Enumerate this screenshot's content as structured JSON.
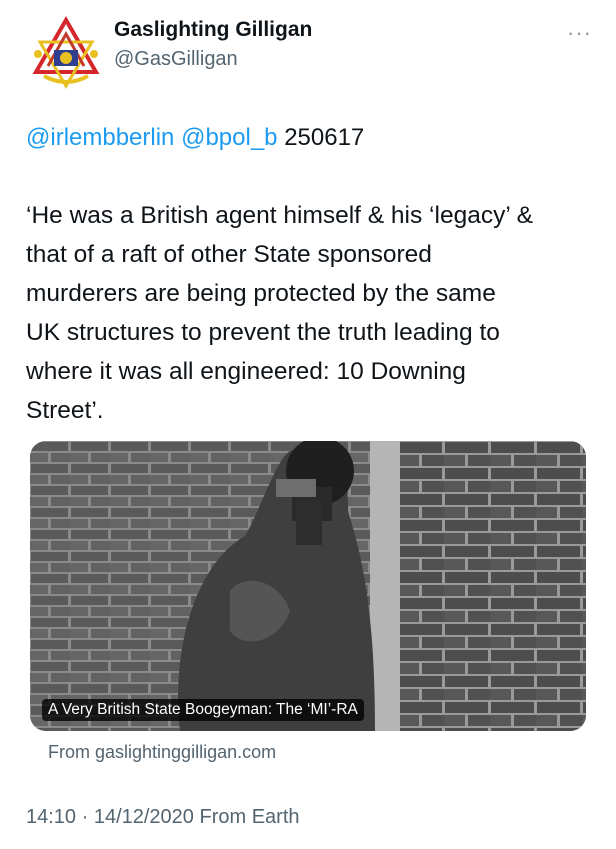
{
  "author": {
    "name": "Gaslighting Gilligan",
    "handle": "@GasGilligan",
    "avatar_icon": "masonic-emblem-icon",
    "more_label": "···"
  },
  "tweet": {
    "mention1": "@irlembberlin",
    "mention2": "@bpol_b",
    "ref": "250617",
    "text": "‘He was a British agent himself & his ‘legacy’ &\nthat of a raft of other State sponsored\nmurderers are being protected by the same\nUK structures to prevent the truth leading to\nwhere it was all engineered: 10 Downing\nStreet’."
  },
  "link_card": {
    "title": "A Very British State Boogeyman: The ‘MI’-RA",
    "source": "From gaslightinggilligan.com"
  },
  "meta": {
    "timestamp": "14:10 · 14/12/2020 From Earth"
  },
  "colors": {
    "link": "#1d9bf0",
    "secondary": "#536471"
  }
}
